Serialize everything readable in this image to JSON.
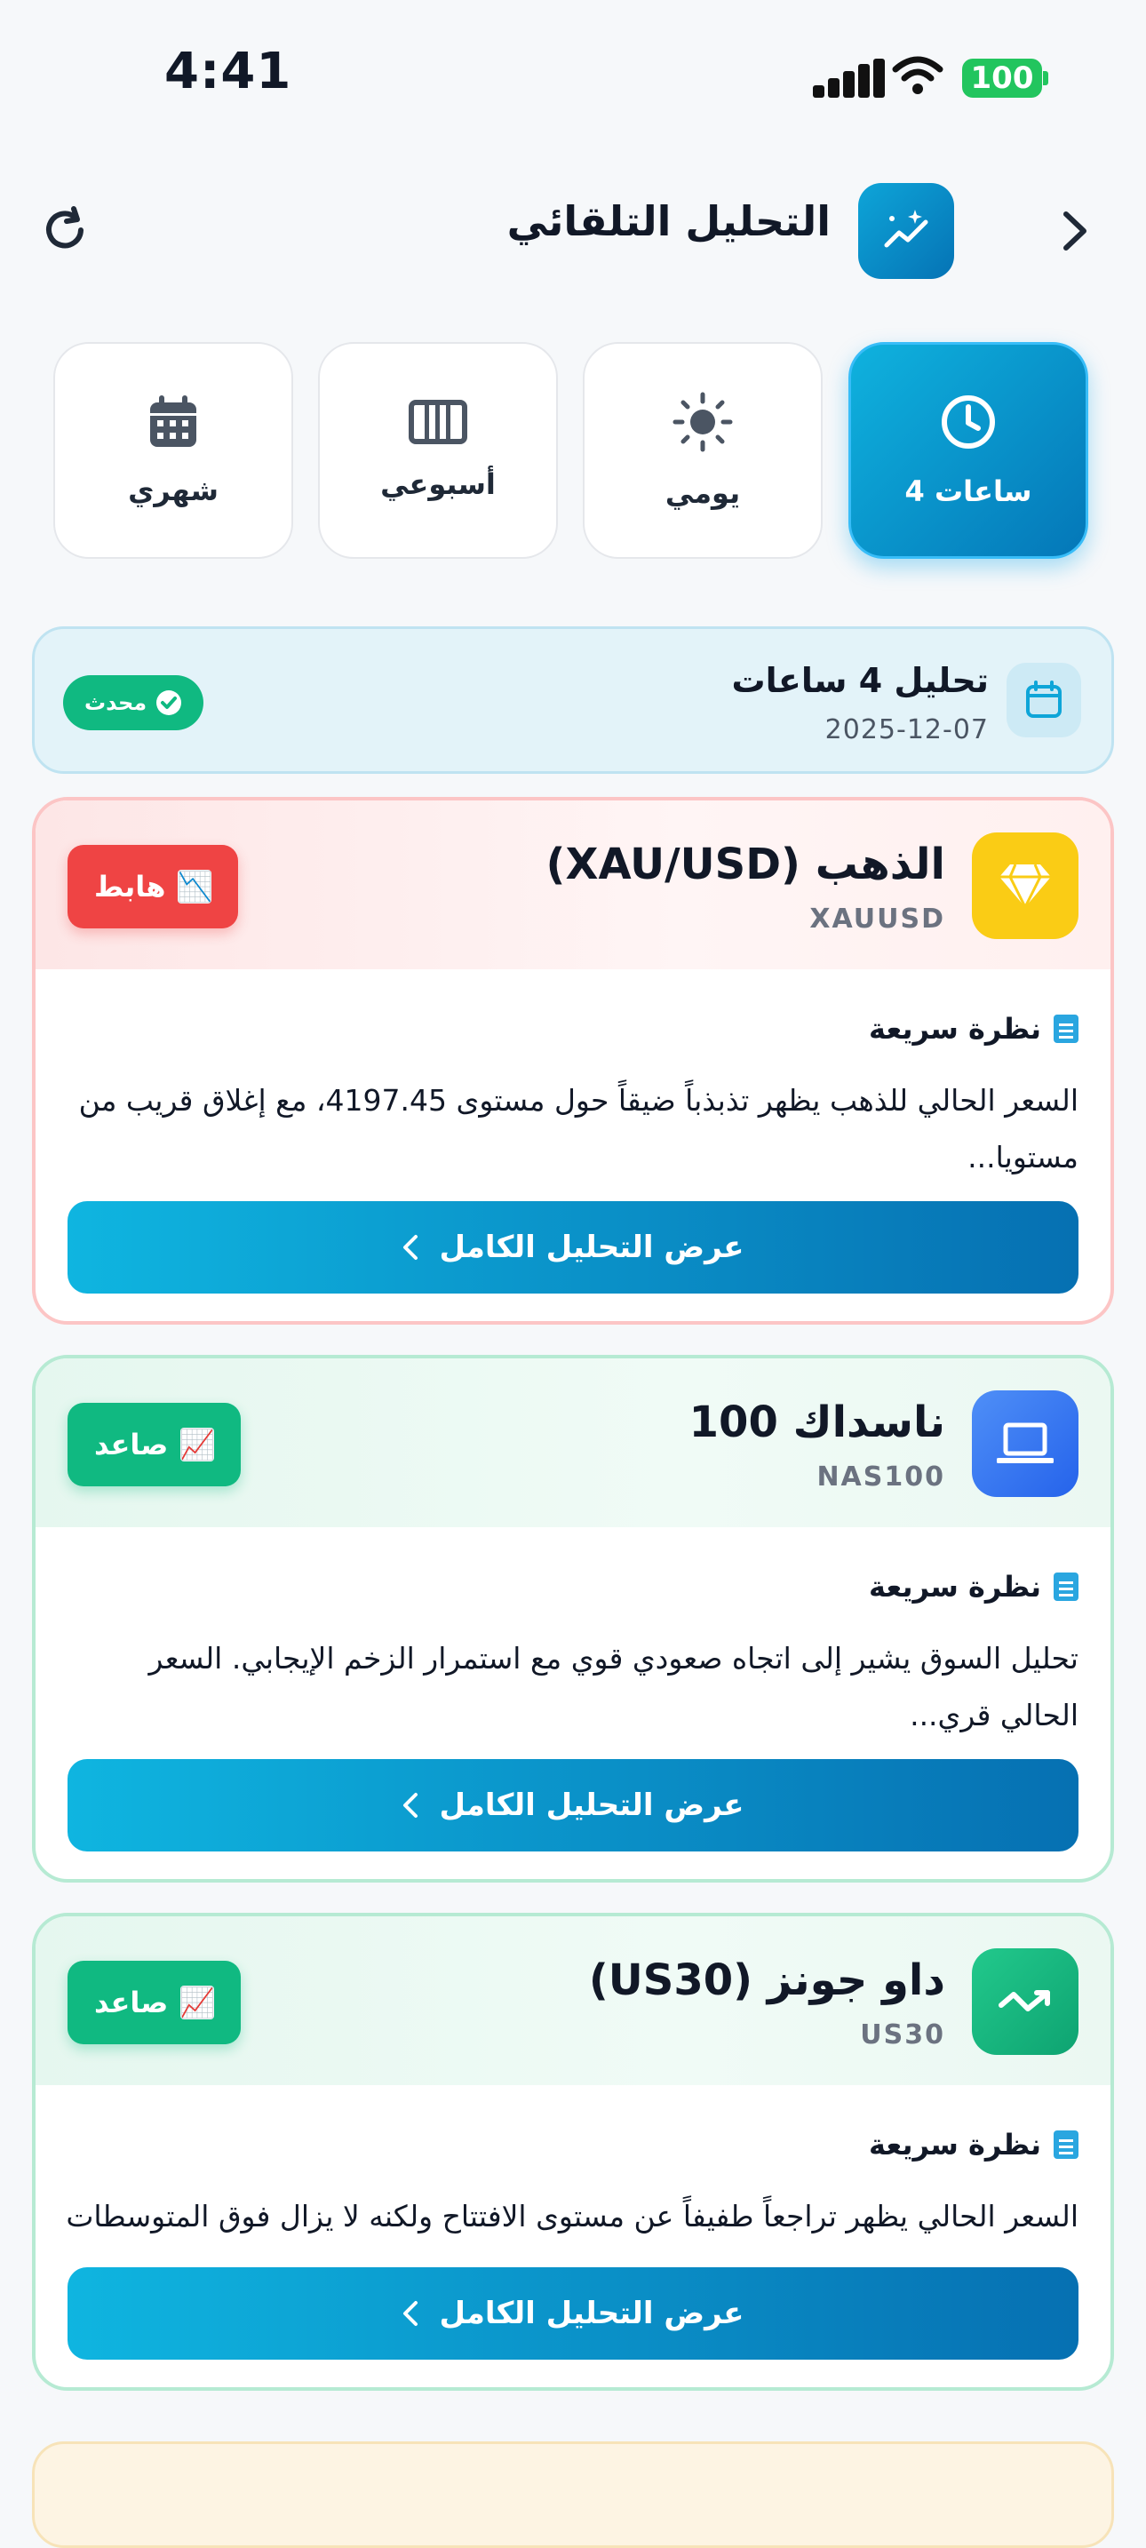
{
  "status_bar": {
    "time": "4:41",
    "battery": "100"
  },
  "header": {
    "title": "التحليل التلقائي"
  },
  "tabs": [
    {
      "label": "4 ساعات",
      "icon": "clock-icon",
      "active": true
    },
    {
      "label": "يومي",
      "icon": "sun-icon",
      "active": false
    },
    {
      "label": "أسبوعي",
      "icon": "columns-icon",
      "active": false
    },
    {
      "label": "شهري",
      "icon": "calendar-grid-icon",
      "active": false
    }
  ],
  "banner": {
    "title": "تحليل 4 ساعات",
    "date": "2025-12-07",
    "badge": "محدث"
  },
  "quick_view_label": "نظرة سريعة",
  "cta_label": "عرض التحليل الكامل",
  "cards": [
    {
      "name": "الذهب (XAU/USD)",
      "code": "XAUUSD",
      "trend": "هابط",
      "trend_icon": "📉",
      "icon": "diamond-icon",
      "icon_color": "#facc15",
      "excerpt": "السعر الحالي للذهب يظهر تذبذباً ضيقاً حول مستوى 4197.45، مع إغلاق قريب من مستويا..."
    },
    {
      "name": "ناسداك 100",
      "code": "NAS100",
      "trend": "صاعد",
      "trend_icon": "📈",
      "icon": "laptop-icon",
      "icon_color": "#3b82f6",
      "excerpt": "تحليل السوق يشير إلى اتجاه صعودي قوي مع استمرار الزخم الإيجابي. السعر الحالي قري..."
    },
    {
      "name": "داو جونز (US30)",
      "code": "US30",
      "trend": "صاعد",
      "trend_icon": "📈",
      "icon": "trend-line-icon",
      "icon_color": "#10b981",
      "excerpt": "السعر الحالي يظهر تراجعاً طفيفاً عن مستوى الافتتاح ولكنه لا يزال فوق المتوسطات ا..."
    }
  ]
}
